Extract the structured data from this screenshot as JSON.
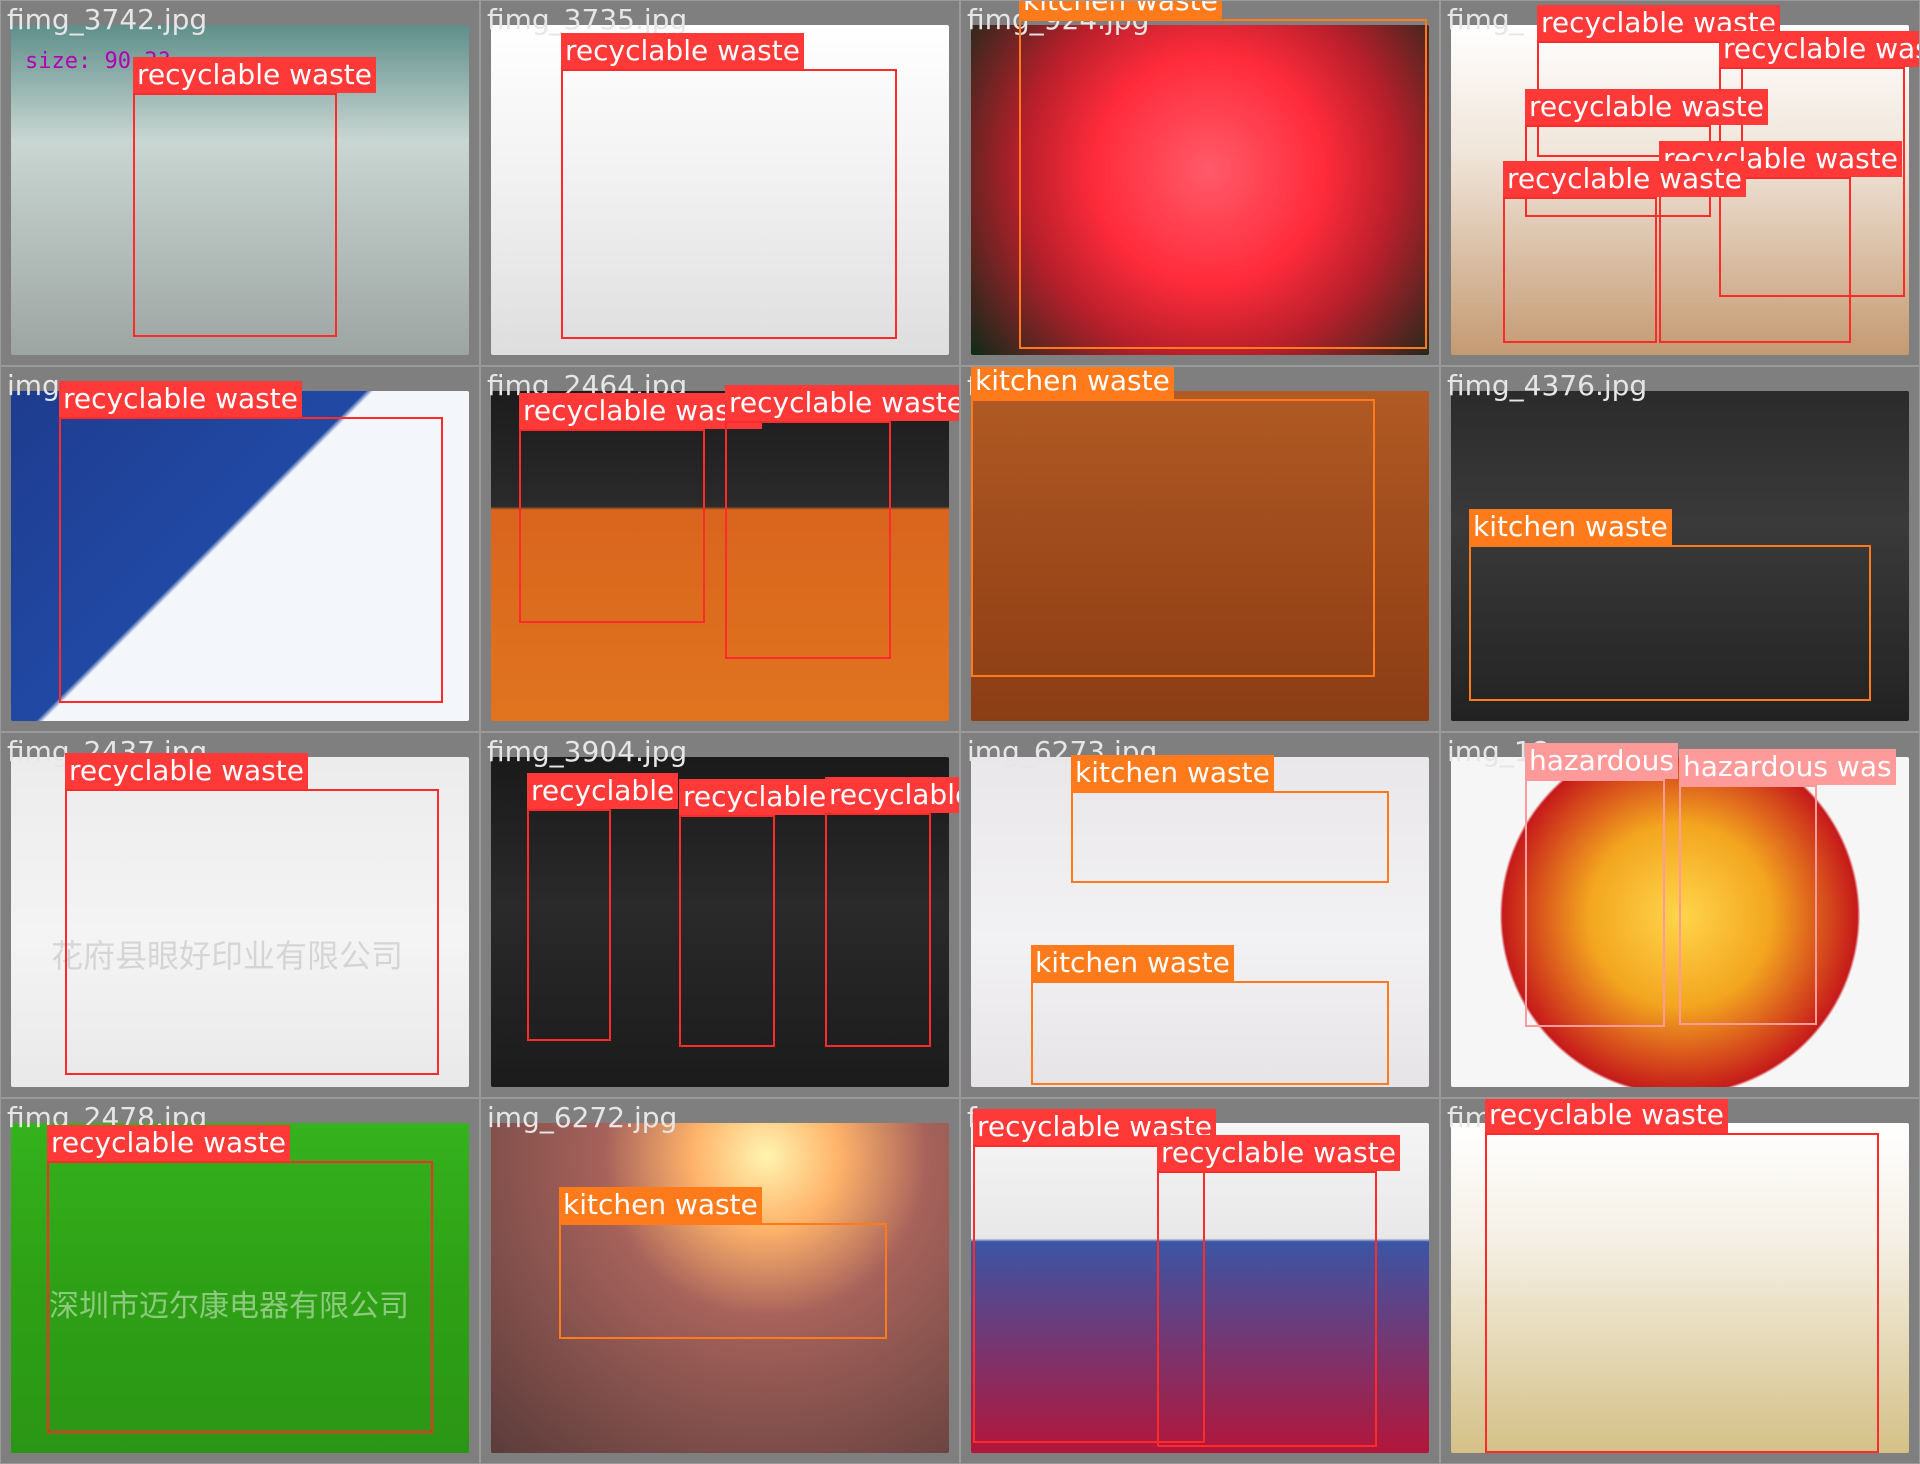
{
  "tiles": [
    {
      "filename": "fimg_3742.jpg",
      "extra": "size: 90 3?",
      "labels": [
        "recyclable waste"
      ]
    },
    {
      "filename": "fimg_3735.jpg",
      "labels": [
        "recyclable waste"
      ]
    },
    {
      "filename": "fimg_924.jpg",
      "labels": [
        "kitchen waste"
      ]
    },
    {
      "filename": "fimg_",
      "labels": [
        "recyclable waste",
        "recyclable waste",
        "recyclable waste",
        "recyclable waste",
        "recyclable waste"
      ]
    },
    {
      "filename": "img",
      "labels": [
        "recyclable waste"
      ]
    },
    {
      "filename": "fimg_2464.jpg",
      "labels": [
        "recyclable waste",
        "recyclable waste"
      ]
    },
    {
      "filename": "f",
      "labels": [
        "kitchen waste"
      ]
    },
    {
      "filename": "fimg_4376.jpg",
      "labels": [
        "kitchen waste"
      ]
    },
    {
      "filename": "fimg_2437.jpg",
      "labels": [
        "recyclable waste"
      ]
    },
    {
      "filename": "fimg_3904.jpg",
      "labels": [
        "recyclable",
        "recyclable",
        "recyclable waste"
      ]
    },
    {
      "filename": "img_6273.jpg",
      "labels": [
        "kitchen waste",
        "kitchen waste"
      ]
    },
    {
      "filename": "img_18",
      "labels": [
        "hazardous",
        "hazardous was"
      ]
    },
    {
      "filename": "fimg_2478.jpg",
      "labels": [
        "recyclable waste"
      ]
    },
    {
      "filename": "img_6272.jpg",
      "labels": [
        "kitchen waste"
      ]
    },
    {
      "filename": "f",
      "labels": [
        "recyclable waste",
        "recyclable waste"
      ]
    },
    {
      "filename": "fimg_",
      "labels": [
        "recyclable waste"
      ]
    }
  ],
  "watermark_texts": [
    "花府县眼好印业有限公司",
    "深圳市迈尔康电器有限公司"
  ],
  "colors": {
    "recyclable": "#ff3838",
    "kitchen": "#ff7a1a",
    "hazardous": "#ff9a9a",
    "background": "#808080"
  }
}
